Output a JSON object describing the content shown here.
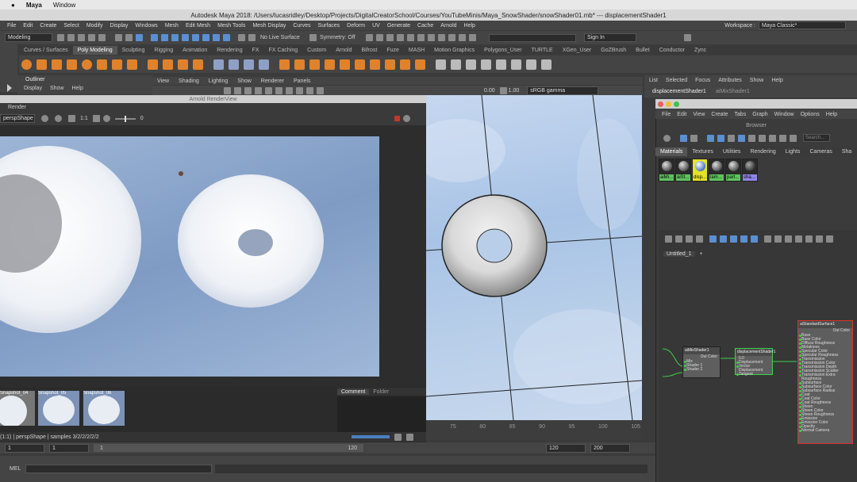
{
  "mac_menu": {
    "apple": "",
    "app": "Maya",
    "window": "Window"
  },
  "title": "Autodesk Maya 2018: /Users/lucasridley/Desktop/Projects/DigitalCreatorSchool/Courses/YouTubeMinis/Maya_SnowShader/snowShader01.mb*   ---   displacementShader1",
  "menu": [
    "File",
    "Edit",
    "Create",
    "Select",
    "Modify",
    "Display",
    "Windows",
    "Mesh",
    "Edit Mesh",
    "Mesh Tools",
    "Mesh Display",
    "Curves",
    "Surfaces",
    "Deform",
    "UV",
    "Generate",
    "Cache",
    "Arnold",
    "Help"
  ],
  "workspace": {
    "label": "Workspace :",
    "value": "Maya Classic*"
  },
  "status_line": {
    "mode": "Modeling",
    "live_surface": "No Live Surface",
    "symmetry": "Symmetry: Off",
    "sign_in": "Sign In"
  },
  "shelf_tabs": [
    "Curves / Surfaces",
    "Poly Modeling",
    "Sculpting",
    "Rigging",
    "Animation",
    "Rendering",
    "FX",
    "FX Caching",
    "Custom",
    "Arnold",
    "Bifrost",
    "Fuze",
    "MASH",
    "Motion Graphics",
    "Polygons_User",
    "TURTLE",
    "XGen_User",
    "GoZBrush",
    "Bullet",
    "Conductor",
    "Zync"
  ],
  "shelf_active": "Poly Modeling",
  "outliner": {
    "title": "Outliner",
    "menu": [
      "Display",
      "Show",
      "Help"
    ]
  },
  "viewport_menu": [
    "View",
    "Shading",
    "Lighting",
    "Show",
    "Renderer",
    "Panels"
  ],
  "viewport_bar": {
    "exposure": "0.00",
    "gamma": "1.00",
    "colorspace": "sRGB gamma"
  },
  "renderview": {
    "title": "Arnold RenderView",
    "menu": "Render",
    "camera": "perspShape",
    "ratio": "1:1",
    "exposure": "0",
    "snapshots": [
      "Snapshot_04",
      "Snapshot_05",
      "Snapshot_06"
    ],
    "tabs": [
      "Comment",
      "Folder"
    ],
    "status": "(1:1) | perspShape | samples 3/2/2/2/2/2"
  },
  "timeline": {
    "ticks": [
      "75",
      "80",
      "85",
      "90",
      "95",
      "100",
      "105"
    ]
  },
  "range": {
    "start": "1",
    "start2": "1",
    "slider_start": "1",
    "slider_end": "120",
    "end": "120",
    "end2": "200"
  },
  "cmd": {
    "label": "MEL"
  },
  "right_panel": {
    "menu": [
      "List",
      "Selected",
      "Focus",
      "Attributes",
      "Show",
      "Help"
    ],
    "node": "displacementShader1",
    "node2": "aiMixShader1"
  },
  "hypershade": {
    "menu": [
      "File",
      "Edit",
      "View",
      "Create",
      "Tabs",
      "Graph",
      "Window",
      "Options",
      "Help"
    ],
    "browser": "Browser",
    "search": "Search...",
    "tabs": [
      "Materials",
      "Textures",
      "Utilities",
      "Rendering",
      "Lights",
      "Cameras",
      "Sha"
    ],
    "swatches": [
      {
        "label": "aiMi...",
        "color": "#5fc45f"
      },
      {
        "label": "aiSt...",
        "color": "#5fc45f"
      },
      {
        "label": "disp...",
        "color": "#e3e32a"
      },
      {
        "label": "lam...",
        "color": "#5fc45f"
      },
      {
        "label": "part...",
        "color": "#5fc45f"
      },
      {
        "label": "sha...",
        "color": "#8f86e6"
      }
    ],
    "graph_tab": "Untitled_1",
    "add_tab": "+",
    "nodes": {
      "mix": {
        "title": "aiMixShader1",
        "out": "Out Color",
        "rows": [
          "Mix",
          "Shader 1",
          "Shader 2"
        ]
      },
      "disp": {
        "title": "displacementShader1",
        "value": "0.0",
        "rows": [
          "Displacement",
          "Vector Displacement",
          "Tangent"
        ]
      },
      "std": {
        "title": "aiStandardSurface1",
        "out": "Out Color",
        "rows": [
          "Base",
          "Base Color",
          "Diffuse Roughness",
          "Metalness",
          "Specular Color",
          "Specular Roughness",
          "Transmission",
          "Transmission Color",
          "Transmission Depth",
          "Transmission Scatter",
          "Transmission Extra Roughness",
          "Subsurface",
          "Subsurface Color",
          "Subsurface Radius",
          "Coat",
          "Coat Color",
          "Coat Roughness",
          "Sheen",
          "Sheen Color",
          "Sheen Roughness",
          "Emission",
          "Emission Color",
          "Opacity",
          "Normal Camera"
        ]
      }
    }
  }
}
